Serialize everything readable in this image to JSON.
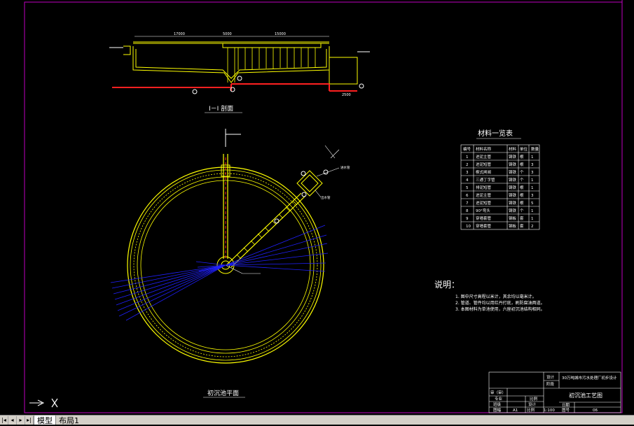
{
  "drawing": {
    "section_title": "I－I 剖面",
    "plan_title": "初沉池平面",
    "section_dims": [
      "17000",
      "5000",
      "15000",
      "2500"
    ],
    "pipe_labels": [
      "进水管",
      "出水管"
    ],
    "materials": {
      "title": "材料一览表",
      "headers": [
        "编号",
        "材料名称",
        "材料",
        "单位",
        "数量"
      ],
      "rows": [
        [
          "1",
          "进泥主管",
          "铸铁",
          "根",
          "1"
        ],
        [
          "2",
          "进泥短管",
          "铸铁",
          "根",
          "3"
        ],
        [
          "3",
          "楔式闸阀",
          "铸铁",
          "个",
          "3"
        ],
        [
          "4",
          "三通丁字管",
          "铸铁",
          "个",
          "1"
        ],
        [
          "5",
          "排泥短管",
          "铸铁",
          "根",
          "1"
        ],
        [
          "6",
          "进泥主管",
          "铸铁",
          "根",
          "3"
        ],
        [
          "7",
          "进泥短管",
          "铸铁",
          "根",
          "5"
        ],
        [
          "8",
          "90°弯头",
          "铸铁",
          "个",
          "1"
        ],
        [
          "9",
          "穿墙套管",
          "钢板",
          "套",
          "1"
        ],
        [
          "10",
          "穿墙套管",
          "钢板",
          "套",
          "2"
        ]
      ]
    },
    "notes": {
      "heading": "说明：",
      "lines": [
        "1. 图中尺寸高程以米计，其余均以毫米计。",
        "2. 管道、管件均以用红丹打底，刷防腐油两道。",
        "3. 本图材料为单池使用，六座初沉池结构相同。"
      ]
    },
    "title_block": {
      "design_label": "设计",
      "stage_label": "阶段",
      "project_name": "30万吨城市污水处理厂初步设计",
      "drawing_name": "初沉池工艺图",
      "review_label": "审（审）",
      "major_label": "专业",
      "scale_label": "比例",
      "class_label": "班级",
      "date_label": "日期",
      "sheet_label": "图幅",
      "sheet_value": "A1",
      "scale_value": "1:100",
      "drawing_no_label": "图号",
      "drawing_no_value": "06"
    }
  },
  "layout_tabs": {
    "nav_buttons": [
      "|◂",
      "◂",
      "▸",
      "▸|"
    ],
    "tabs": [
      "模型",
      "布局1"
    ],
    "active": "模型"
  },
  "colors": {
    "background": "#000000",
    "border": "#c000c0",
    "structure": "#ffff00",
    "pipe": "#ff2020",
    "line": "#ffffff",
    "dimension": "#2020ff"
  }
}
